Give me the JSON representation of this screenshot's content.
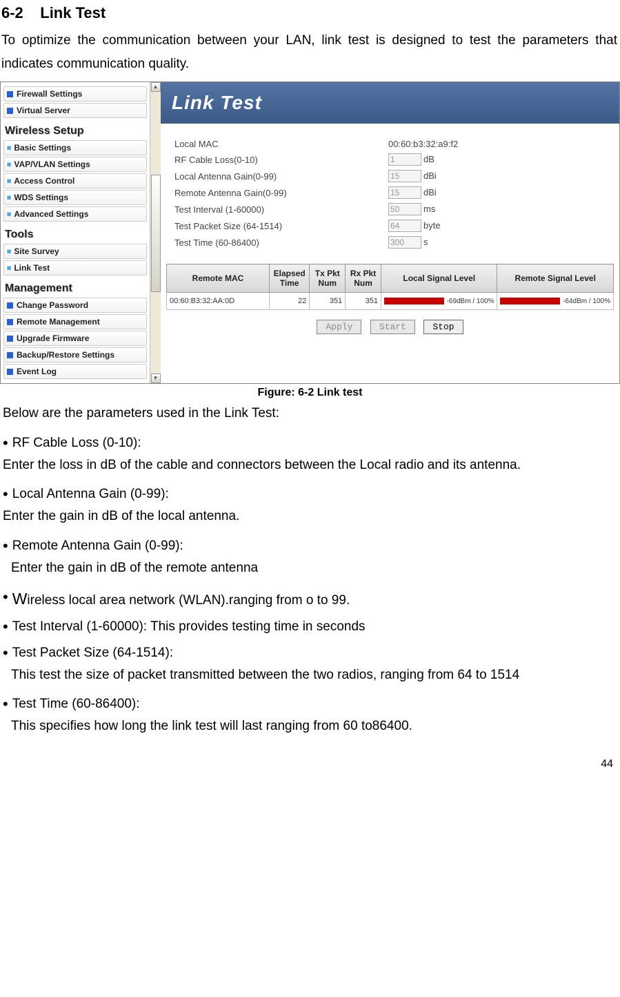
{
  "page": {
    "section_num": "6-2",
    "section_title": "Link Test",
    "intro": "To optimize the communication between your LAN, link test is designed to test the parameters that indicates communication quality.",
    "caption": "Figure: 6-2 Link test",
    "below_params": "Below are the parameters used in the Link Test:",
    "page_number": "44"
  },
  "sidebar": {
    "items_top": [
      {
        "label": "Firewall Settings",
        "type": "sq"
      },
      {
        "label": "Virtual Server",
        "type": "sq"
      }
    ],
    "group_wireless": {
      "header": "Wireless Setup",
      "items": [
        {
          "label": "Basic Settings"
        },
        {
          "label": "VAP/VLAN Settings"
        },
        {
          "label": "Access Control"
        },
        {
          "label": "WDS Settings"
        },
        {
          "label": "Advanced Settings"
        }
      ]
    },
    "group_tools": {
      "header": "Tools",
      "items": [
        {
          "label": "Site Survey"
        },
        {
          "label": "Link Test"
        }
      ]
    },
    "group_mgmt": {
      "header": "Management",
      "items": [
        {
          "label": "Change Password",
          "type": "sq"
        },
        {
          "label": "Remote Management",
          "type": "sq"
        },
        {
          "label": "Upgrade Firmware",
          "type": "sq"
        },
        {
          "label": "Backup/Restore Settings",
          "type": "sq"
        },
        {
          "label": "Event Log",
          "type": "sq"
        }
      ]
    }
  },
  "panel": {
    "banner": "Link Test",
    "fields": {
      "local_mac_label": "Local MAC",
      "local_mac_value": "00:60:b3:32:a9:f2",
      "rf_label": "RF Cable Loss(0-10)",
      "rf_value": "1",
      "rf_unit": "dB",
      "lag_label": "Local Antenna Gain(0-99)",
      "lag_value": "15",
      "lag_unit": "dBi",
      "rag_label": "Remote Antenna Gain(0-99)",
      "rag_value": "15",
      "rag_unit": "dBi",
      "ti_label": "Test Interval (1-60000)",
      "ti_value": "50",
      "ti_unit": "ms",
      "tps_label": "Test Packet Size (64-1514)",
      "tps_value": "64",
      "tps_unit": "byte",
      "tt_label": "Test Time (60-86400)",
      "tt_value": "300",
      "tt_unit": "s"
    },
    "table": {
      "headers": [
        "Remote MAC",
        "Elapsed Time",
        "Tx Pkt Num",
        "Rx Pkt Num",
        "Local Signal Level",
        "Remote Signal Level"
      ],
      "row": {
        "mac": "00:60:B3:32:AA:0D",
        "elapsed": "22",
        "tx": "351",
        "rx": "351",
        "local": "-69dBm / 100%",
        "remote": "-64dBm / 100%"
      }
    },
    "buttons": {
      "apply": "Apply",
      "start": "Start",
      "stop": "Stop"
    }
  },
  "bullets": [
    {
      "head": "RF Cable Loss (0-10):",
      "body": "Enter the loss in dB of the cable and connectors between the Local radio and its antenna.",
      "indent": false
    },
    {
      "head": "Local Antenna Gain (0-99):",
      "body": "Enter the gain in dB of the local antenna.",
      "indent": false
    },
    {
      "head": "Remote Antenna Gain (0-99):",
      "body": "Enter the gain in dB of the remote antenna",
      "indent": true
    },
    {
      "head": "Wireless local area network (WLAN).ranging from o to 99.",
      "body": "",
      "indent": false,
      "bigW": true
    },
    {
      "head": "Test Interval (1-60000): This provides testing time in seconds",
      "body": "",
      "indent": false
    },
    {
      "head": "Test Packet Size (64-1514):",
      "body": "This test the size of packet transmitted between the two radios, ranging from 64 to 1514",
      "indent": true
    },
    {
      "head": "Test Time (60-86400):",
      "body": "This specifies how long the link test will last ranging from 60 to86400.",
      "indent": true
    }
  ]
}
